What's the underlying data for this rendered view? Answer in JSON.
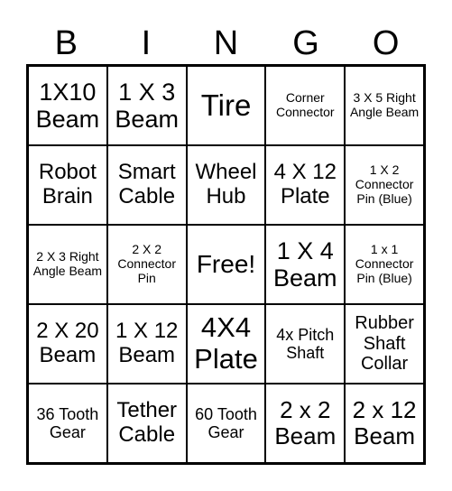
{
  "header": [
    "B",
    "I",
    "N",
    "G",
    "O"
  ],
  "cells": [
    "1X10 Beam",
    "1 X 3 Beam",
    "Tire",
    "Corner Connector",
    "3 X 5 Right Angle Beam",
    "Robot Brain",
    "Smart Cable",
    "Wheel Hub",
    "4 X 12 Plate",
    "1 X 2 Connector Pin (Blue)",
    "2 X 3 Right Angle Beam",
    "2 X 2 Connector Pin",
    "Free!",
    "1 X 4 Beam",
    "1 x 1 Connector Pin (Blue)",
    "2 X 20 Beam",
    "1 X 12 Beam",
    "4X4 Plate",
    "4x Pitch Shaft",
    "Rubber Shaft Collar",
    "36 Tooth Gear",
    "Tether Cable",
    "60 Tooth Gear",
    "2 x 2 Beam",
    "2 x 12 Beam"
  ]
}
